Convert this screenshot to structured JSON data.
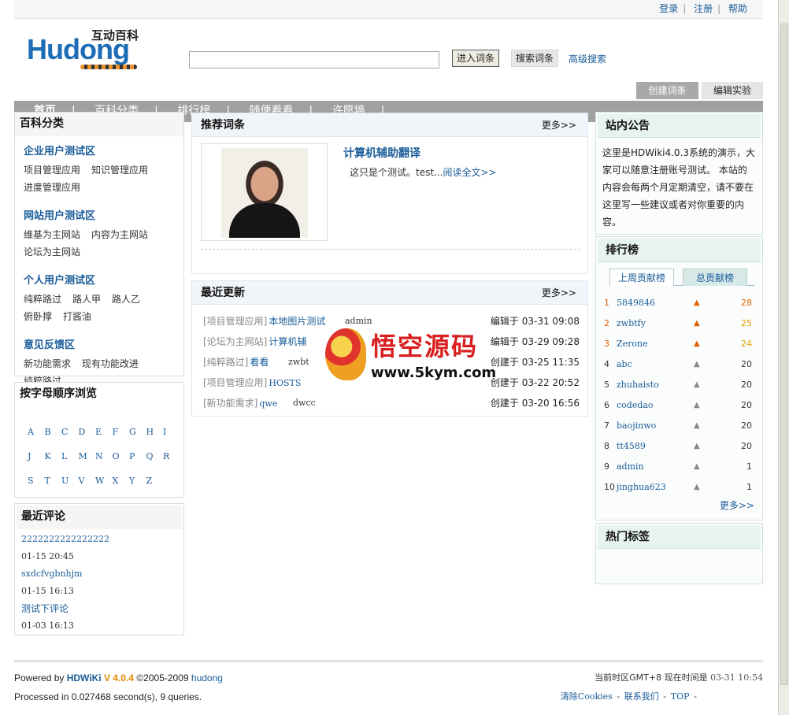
{
  "topbar": {
    "login": "登录",
    "register": "注册",
    "help": "帮助",
    "sep": "|"
  },
  "logo": {
    "latin": "Hudong",
    "cn": "互动百科"
  },
  "search": {
    "enter_label": "进入词条",
    "search_label": "搜索词条",
    "advanced": "高级搜索"
  },
  "header_buttons": {
    "create": "创建词条",
    "lab": "编辑实验"
  },
  "nav": {
    "items": [
      "首页",
      "百科分类",
      "排行榜",
      "随便看看",
      "许愿墙"
    ],
    "sep": "|"
  },
  "categories": {
    "title": "百科分类",
    "groups": [
      {
        "name": "企业用户测试区",
        "items": [
          "项目管理应用",
          "知识管理应用",
          "进度管理应用"
        ]
      },
      {
        "name": "网站用户测试区",
        "items": [
          "维基为主网站",
          "内容为主网站",
          "论坛为主网站"
        ]
      },
      {
        "name": "个人用户测试区",
        "items": [
          "纯粹路过",
          "路人甲",
          "路人乙",
          "俯卧撑",
          "打酱油"
        ]
      },
      {
        "name": "意见反馈区",
        "items": [
          "新功能需求",
          "现有功能改进",
          "纯粹路过"
        ]
      }
    ]
  },
  "alpha": {
    "title": "按字母顺序浏览",
    "rows": [
      [
        "A",
        "B",
        "C",
        "D",
        "E",
        "F",
        "G",
        "H",
        "I"
      ],
      [
        "J",
        "K",
        "L",
        "M",
        "N",
        "O",
        "P",
        "Q",
        "R"
      ],
      [
        "S",
        "T",
        "U",
        "V",
        "W",
        "X",
        "Y",
        "Z"
      ]
    ]
  },
  "comments": {
    "title": "最近评论",
    "items": [
      {
        "text": "2222222222222222",
        "date": "01-15 20:45"
      },
      {
        "text": "sxdcfvgbnhjm",
        "date": "01-15 16:13"
      },
      {
        "text": "测试下评论",
        "date": "01-03 16:13"
      }
    ]
  },
  "recommend": {
    "title": "推荐词条",
    "more": "更多>>",
    "entry_title": "计算机辅助翻译",
    "entry_desc": "这只是个测试。test...",
    "read_more": "阅读全文>>"
  },
  "updates": {
    "title": "最近更新",
    "more": "更多>>",
    "rows": [
      {
        "cat": "[项目管理应用]",
        "title": "本地图片测试",
        "user": "admin",
        "time": "编辑于 03-31 09:08"
      },
      {
        "cat": "[论坛为主网站]",
        "title": "计算机辅",
        "user": "",
        "time": "编辑于 03-29 09:28"
      },
      {
        "cat": "[纯粹路过]",
        "title": "看看",
        "user": "zwbt",
        "time": "创建于 03-25 11:35"
      },
      {
        "cat": "[项目管理应用]",
        "title": "HOSTS",
        "user": "",
        "time": "创建于 03-22 20:52"
      },
      {
        "cat": "[新功能需求]",
        "title": "qwe",
        "user": "dwcc",
        "time": "创建于 03-20 16:56"
      }
    ]
  },
  "notice": {
    "title": "站内公告",
    "text": "这里是HDWiki4.0.3系统的演示，大家可以随意注册账号测试。 本站的内容会每两个月定期清空，请不要在这里写一些建议或者对你重要的内容。"
  },
  "ranking": {
    "title": "排行榜",
    "tab_week": "上周贡献榜",
    "tab_total": "总贡献榜",
    "more": "更多>>",
    "rows": [
      {
        "rank": "1",
        "name": "5849846",
        "score": "28"
      },
      {
        "rank": "2",
        "name": "zwbtfy",
        "score": "25"
      },
      {
        "rank": "3",
        "name": "Zerone",
        "score": "24"
      },
      {
        "rank": "4",
        "name": "abc",
        "score": "20"
      },
      {
        "rank": "5",
        "name": "zhuhaisto",
        "score": "20"
      },
      {
        "rank": "6",
        "name": "codedao",
        "score": "20"
      },
      {
        "rank": "7",
        "name": "baojinwo",
        "score": "20"
      },
      {
        "rank": "8",
        "name": "tt4589",
        "score": "20"
      },
      {
        "rank": "9",
        "name": "admin",
        "score": "1"
      },
      {
        "rank": "10",
        "name": "jinghua623",
        "score": "1"
      }
    ]
  },
  "tags": {
    "title": "热门标签"
  },
  "watermark": {
    "cn": "悟空源码",
    "url": "www.5kym.com"
  },
  "footer": {
    "powered": "Powered by",
    "brand": "HDWiKi",
    "version": "V 4.0.4",
    "copy": "©2005-2009",
    "company": "hudong",
    "processed": "Processed in 0.027468 second(s), 9 queries.",
    "tz": "当前时区GMT+8 现在时间是",
    "now": "03-31 10:54",
    "clear_cookies": "清除Cookies",
    "contact": "联系我们",
    "top": "TOP",
    "dash": "-"
  }
}
